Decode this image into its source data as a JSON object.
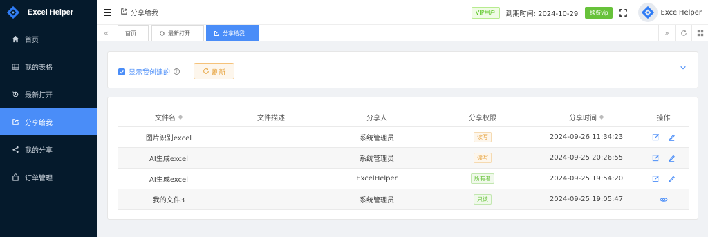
{
  "app": {
    "name": "Excel Helper"
  },
  "sidebar": {
    "items": [
      {
        "label": "首页",
        "icon": "home-icon"
      },
      {
        "label": "我的表格",
        "icon": "table-icon"
      },
      {
        "label": "最新打开",
        "icon": "history-icon"
      },
      {
        "label": "分享给我",
        "icon": "share-in-icon",
        "active": true
      },
      {
        "label": "我的分享",
        "icon": "share-icon"
      },
      {
        "label": "订单管理",
        "icon": "bag-icon"
      }
    ]
  },
  "header": {
    "breadcrumb": "分享给我",
    "vip_badge": "VIP用户",
    "expire_label": "到期时间: 2024-10-29",
    "renew_label": "续费vip",
    "username": "ExcelHelper"
  },
  "tabs": [
    {
      "label": "首页"
    },
    {
      "label": "最新打开"
    },
    {
      "label": "分享给我",
      "active": true
    }
  ],
  "filter": {
    "show_mine_label": "显示我创建的",
    "refresh_label": "刷新"
  },
  "table": {
    "columns": [
      "文件名",
      "文件描述",
      "分享人",
      "分享权限",
      "分享时间",
      "操作"
    ],
    "rows": [
      {
        "name": "图片识别excel",
        "desc": "",
        "sharer": "系统管理员",
        "permission": "读写",
        "time": "2024-09-26 11:34:23",
        "actions": [
          "edit",
          "pen"
        ]
      },
      {
        "name": "AI生成excel",
        "desc": "",
        "sharer": "系统管理员",
        "permission": "读写",
        "time": "2024-09-25 20:26:55",
        "actions": [
          "edit",
          "pen"
        ]
      },
      {
        "name": "AI生成excel",
        "desc": "",
        "sharer": "ExcelHelper",
        "permission": "所有者",
        "time": "2024-09-25 19:54:20",
        "actions": [
          "edit",
          "pen"
        ]
      },
      {
        "name": "我的文件3",
        "desc": "",
        "sharer": "系统管理员",
        "permission": "只读",
        "time": "2024-09-25 19:05:47",
        "actions": [
          "view"
        ]
      }
    ]
  },
  "colors": {
    "sidebar_bg": "#051a2c",
    "accent": "#4a8df8",
    "warning": "#e6a23c",
    "success": "#67c23a"
  }
}
